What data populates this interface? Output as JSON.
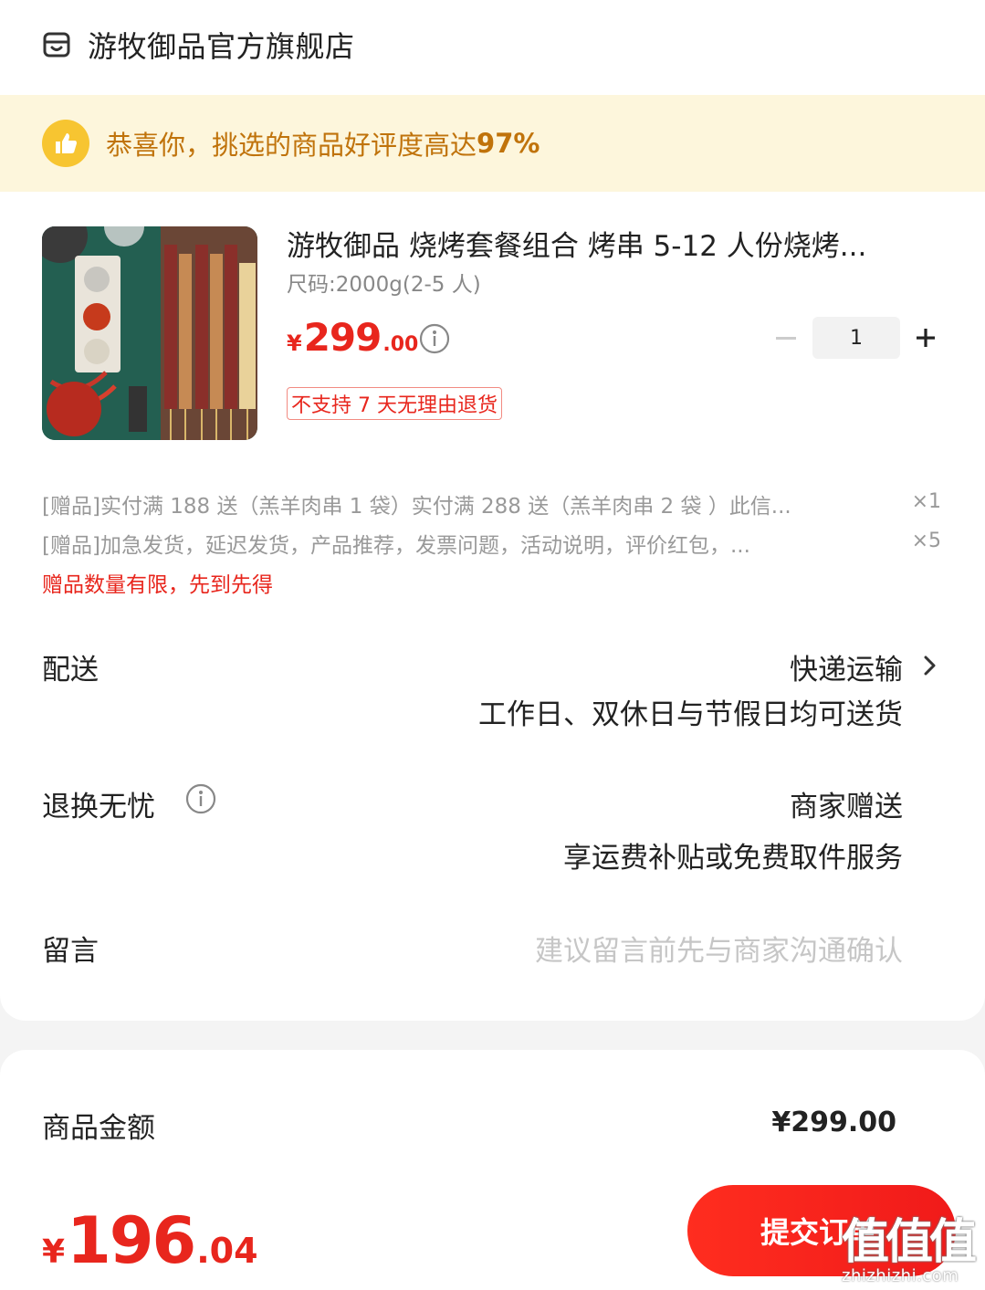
{
  "store": {
    "name": "游牧御品官方旗舰店",
    "icon": "store-icon"
  },
  "banner": {
    "text": "恭喜你，挑选的商品好评度高达",
    "percent": "97%",
    "icon": "thumbs-up-icon"
  },
  "product": {
    "title": "游牧御品 烧烤套餐组合 烤串 5-12 人份烧烤...",
    "spec": "尺码:2000g(2-5 人)",
    "price": {
      "yen": "¥",
      "int": "299",
      "dec": ".00"
    },
    "quantity": "1",
    "tag": "不支持 7 天无理由退货"
  },
  "gifts": [
    {
      "text": "[赠品]实付满 188 送（羔羊肉串 1 袋）实付满 288 送（羔羊肉串 2 袋 ）此信...",
      "count": "×1"
    },
    {
      "text": "[赠品]加急发货，延迟发货，产品推荐，发票问题，活动说明，评价红包，...",
      "count": "×5"
    }
  ],
  "gift_note": "赠品数量有限，先到先得",
  "delivery": {
    "label": "配送",
    "value": "快递运输",
    "sub": "工作日、双休日与节假日均可送货"
  },
  "returns": {
    "label": "退换无忧",
    "value": "商家赠送",
    "sub": "享运费补贴或免费取件服务"
  },
  "message": {
    "label": "留言",
    "placeholder": "建议留言前先与商家沟通确认"
  },
  "summary": {
    "label": "商品金额",
    "value": "¥299.00"
  },
  "total": {
    "yen": "¥",
    "int": "196",
    "dec": ".04"
  },
  "submit_label": "提交订单",
  "watermark": {
    "glyphs": "值值值",
    "url": "zhizhizhi.com"
  },
  "colors": {
    "accent": "#e8261d",
    "banner_bg": "#fdf6dc",
    "banner_text": "#c0730b",
    "badge": "#f7c531"
  }
}
